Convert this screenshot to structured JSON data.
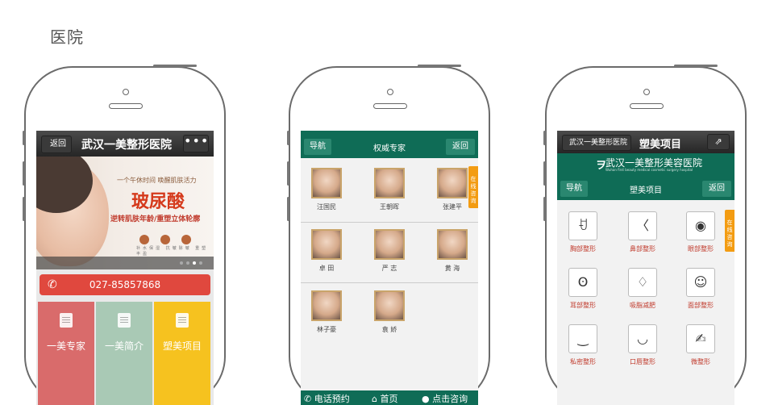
{
  "section_title": "医院",
  "screen1": {
    "back_label": "返回",
    "title": "武汉一美整形医院",
    "more_label": "•••",
    "banner": {
      "tagline": "一个午休时间 唤醒肌肤活力",
      "headline": "玻尿酸",
      "subline": "逆转肌肤年龄/重塑立体轮廓",
      "icon_labels": "补水保湿 抗皱除皱 重塑丰盈"
    },
    "phone_icon": "phone-icon",
    "phone_number": "027-85857868",
    "tiles": [
      {
        "label": "一美专家",
        "color": "#d96b6b"
      },
      {
        "label": "一美简介",
        "color": "#a9c9b5"
      },
      {
        "label": "塑美项目",
        "color": "#f6c21f"
      }
    ]
  },
  "screen2": {
    "nav_label": "导航",
    "title": "权威专家",
    "back_label": "返回",
    "online_tab": "在线咨询",
    "doctors": [
      "汪国民",
      "王朝晖",
      "张建平",
      "卓 田",
      "严 志",
      "黄 海",
      "林子豪",
      "袁 娇"
    ],
    "bottom_bar": {
      "call": "电话预约",
      "home": "首页",
      "consult": "点击咨询"
    }
  },
  "screen3": {
    "back_label": "武汉一美整形医院",
    "title": "塑美项目",
    "share_icon": "share-icon",
    "hospital_name": "武汉一美整形美容医院",
    "hospital_sub": "Wuhan first beauty medical cosmetic surgery hospital",
    "nav_label": "导航",
    "section": "塑美项目",
    "back2_label": "返回",
    "online_tab": "在线咨询",
    "projects": [
      {
        "name": "胸部整形",
        "icon": "ꀀ"
      },
      {
        "name": "鼻部整形",
        "icon": "〈"
      },
      {
        "name": "眼部整形",
        "icon": "◉"
      },
      {
        "name": "耳部整形",
        "icon": "ʘ"
      },
      {
        "name": "吸脂减肥",
        "icon": "♢"
      },
      {
        "name": "面部整形",
        "icon": "☺"
      },
      {
        "name": "私密整形",
        "icon": "‿"
      },
      {
        "name": "口唇整形",
        "icon": "◡"
      },
      {
        "name": "微整形",
        "icon": "✍"
      }
    ]
  }
}
